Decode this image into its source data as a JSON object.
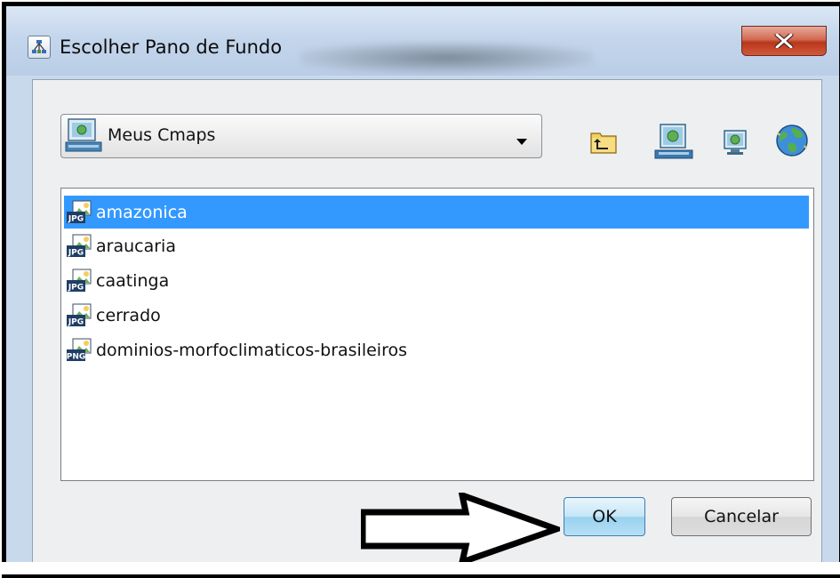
{
  "dialog": {
    "title": "Escolher Pano de Fundo",
    "close_icon": "close-x-icon"
  },
  "location": {
    "selected": "Meus Cmaps",
    "icon": "computer-icon",
    "dropdown_icon": "chevron-down-icon"
  },
  "toolbar": {
    "buttons": [
      {
        "icon": "folder-up-icon"
      },
      {
        "icon": "cmaps-computer-icon"
      },
      {
        "icon": "desktop-icon"
      },
      {
        "icon": "web-globe-icon"
      }
    ]
  },
  "files": [
    {
      "name": "amazonica",
      "type": "JPG",
      "selected": true
    },
    {
      "name": "araucaria",
      "type": "JPG",
      "selected": false
    },
    {
      "name": "caatinga",
      "type": "JPG",
      "selected": false
    },
    {
      "name": "cerrado",
      "type": "JPG",
      "selected": false
    },
    {
      "name": "dominios-morfoclimaticos-brasileiros",
      "type": "PNG",
      "selected": false
    }
  ],
  "buttons": {
    "ok": "OK",
    "cancel": "Cancelar"
  },
  "colors": {
    "selection": "#3399ff",
    "close_button": "#c9452a",
    "ok_button": "#b6e0f5"
  }
}
